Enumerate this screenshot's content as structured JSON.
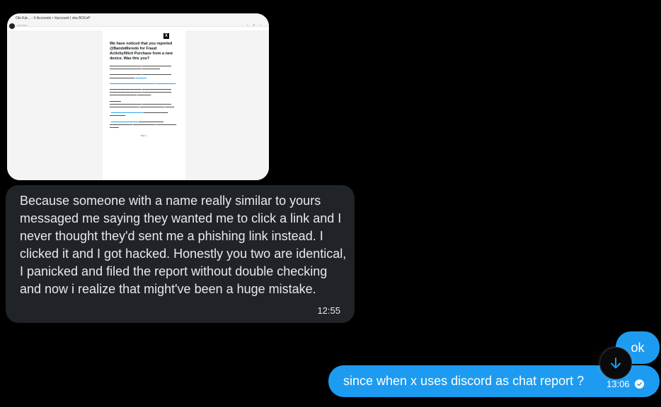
{
  "attachment": {
    "tab_title": "Ole Kat... - X Accounts • Xaccount | vba BCKoP",
    "email_heading": "We have noticed that you reported @BandoMeredo for Fraud Activity/Illicit Purchase from a new device. Was this you?",
    "email_link_text": "http://...",
    "close_logo": "X"
  },
  "conversation": {
    "received_message": {
      "text": "Because someone with a name really similar to yours messaged me saying they wanted me to click a link and I never thought they'd sent me a phishing link instead. I clicked it and I got hacked. Honestly you two are identical, I panicked and filed the report without double checking and now i realize that might've been a huge mistake.",
      "time": "12:55"
    },
    "sent_messages": [
      {
        "text": "ok"
      },
      {
        "text": "since when x uses discord as chat report ?",
        "time": "13:06"
      }
    ]
  },
  "colors": {
    "background": "#000000",
    "received_bubble": "#202327",
    "sent_bubble": "#1d9bf0",
    "text": "#e7e9ea"
  },
  "icons": {
    "scroll_down": "arrow-down-icon",
    "read_receipt": "check-circle-icon"
  }
}
